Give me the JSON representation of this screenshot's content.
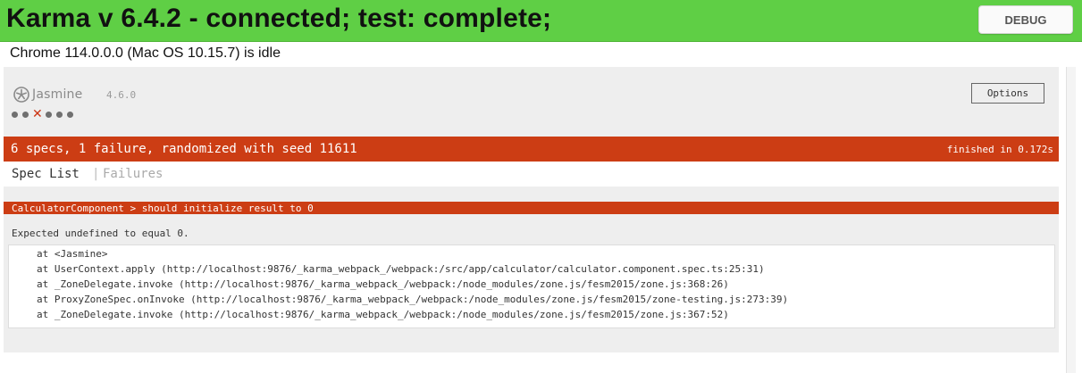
{
  "karma": {
    "title": "Karma v 6.4.2 - connected; test: complete;",
    "debug_label": "DEBUG",
    "browser_status": "Chrome 114.0.0.0 (Mac OS 10.15.7) is idle"
  },
  "jasmine": {
    "name": "Jasmine",
    "version": "4.6.0",
    "options_label": "Options",
    "symbol_summary": [
      "passed",
      "passed",
      "failed",
      "passed",
      "passed",
      "passed"
    ],
    "summary": "6 specs, 1 failure, randomized with seed 11611",
    "duration": "finished in 0.172s",
    "menu": {
      "spec_list": "Spec List",
      "separator": "|",
      "failures": "Failures"
    },
    "failure": {
      "title": "CalculatorComponent > should initialize result to 0",
      "message": "Expected undefined to equal 0.",
      "stack": [
        "at <Jasmine>",
        "at UserContext.apply (http://localhost:9876/_karma_webpack_/webpack:/src/app/calculator/calculator.component.spec.ts:25:31)",
        "at _ZoneDelegate.invoke (http://localhost:9876/_karma_webpack_/webpack:/node_modules/zone.js/fesm2015/zone.js:368:26)",
        "at ProxyZoneSpec.onInvoke (http://localhost:9876/_karma_webpack_/webpack:/node_modules/zone.js/fesm2015/zone-testing.js:273:39)",
        "at _ZoneDelegate.invoke (http://localhost:9876/_karma_webpack_/webpack:/node_modules/zone.js/fesm2015/zone.js:367:52)"
      ]
    }
  },
  "colors": {
    "karma_connected": "#5fcf45",
    "failure": "#cc3d14",
    "failed_symbol": "#cc3311",
    "passed_symbol": "#707070"
  },
  "icons": {
    "jasmine_logo": "jasmine-flower-icon",
    "failed_spec": "x-mark",
    "passed_spec": "dot"
  }
}
